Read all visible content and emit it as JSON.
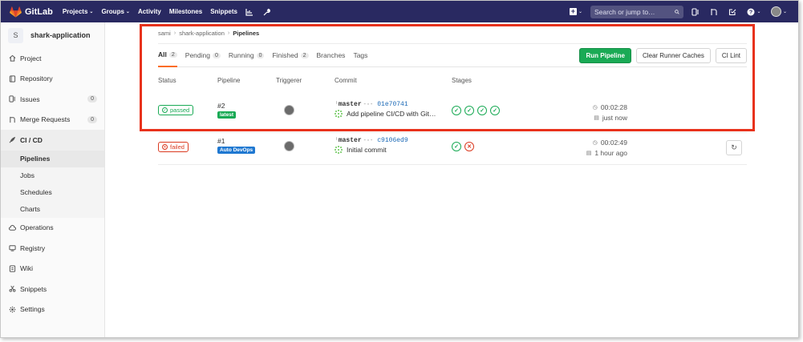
{
  "topnav": {
    "brand": "GitLab",
    "items": [
      {
        "label": "Projects",
        "dropdown": true
      },
      {
        "label": "Groups",
        "dropdown": true
      },
      {
        "label": "Activity",
        "dropdown": false
      },
      {
        "label": "Milestones",
        "dropdown": false
      },
      {
        "label": "Snippets",
        "dropdown": false
      }
    ],
    "icons": [
      "chart-icon",
      "wrench-icon"
    ],
    "search_placeholder": "Search or jump to…",
    "right_icons": [
      "issues-icon",
      "merge-request-icon",
      "todo-icon",
      "help-icon",
      "avatar"
    ],
    "colors": {
      "bar": "#292961",
      "accent": "#fc6d26"
    }
  },
  "sidebar": {
    "project_initial": "S",
    "project_name": "shark-application",
    "items": [
      {
        "label": "Project",
        "icon": "home-icon",
        "count": ""
      },
      {
        "label": "Repository",
        "icon": "book-icon",
        "count": ""
      },
      {
        "label": "Issues",
        "icon": "issues-icon",
        "count": "0"
      },
      {
        "label": "Merge Requests",
        "icon": "merge-request-icon",
        "count": "0"
      },
      {
        "label": "CI / CD",
        "icon": "rocket-icon",
        "count": ""
      }
    ],
    "sub_items": [
      "Pipelines",
      "Jobs",
      "Schedules",
      "Charts"
    ],
    "items_after": [
      {
        "label": "Operations",
        "icon": "cloud-icon"
      },
      {
        "label": "Registry",
        "icon": "container-icon"
      },
      {
        "label": "Wiki",
        "icon": "wiki-icon"
      },
      {
        "label": "Snippets",
        "icon": "scissors-icon"
      },
      {
        "label": "Settings",
        "icon": "gear-icon"
      }
    ]
  },
  "breadcrumb": {
    "path": [
      "sami",
      "shark-application"
    ],
    "current": "Pipelines"
  },
  "tabs": [
    {
      "label": "All",
      "count": "2"
    },
    {
      "label": "Pending",
      "count": "0"
    },
    {
      "label": "Running",
      "count": "0"
    },
    {
      "label": "Finished",
      "count": "2"
    },
    {
      "label": "Branches",
      "count": ""
    },
    {
      "label": "Tags",
      "count": ""
    }
  ],
  "actions": {
    "run": "Run Pipeline",
    "clear": "Clear Runner Caches",
    "lint": "CI Lint"
  },
  "columns": {
    "status": "Status",
    "pipeline": "Pipeline",
    "triggerer": "Triggerer",
    "commit": "Commit",
    "stages": "Stages"
  },
  "pipelines": [
    {
      "status": "passed",
      "id": "#2",
      "tag": "latest",
      "branch": "master",
      "sha": "01e70741",
      "message": "Add pipeline CI/CD with Git…",
      "stages": [
        "ok",
        "ok",
        "ok",
        "ok"
      ],
      "duration": "00:02:28",
      "finished": "just now"
    },
    {
      "status": "failed",
      "id": "#1",
      "tag": "Auto DevOps",
      "branch": "master",
      "sha": "c9106ed9",
      "message": "Initial commit",
      "stages": [
        "ok",
        "fail"
      ],
      "duration": "00:02:49",
      "finished": "1 hour ago"
    }
  ]
}
